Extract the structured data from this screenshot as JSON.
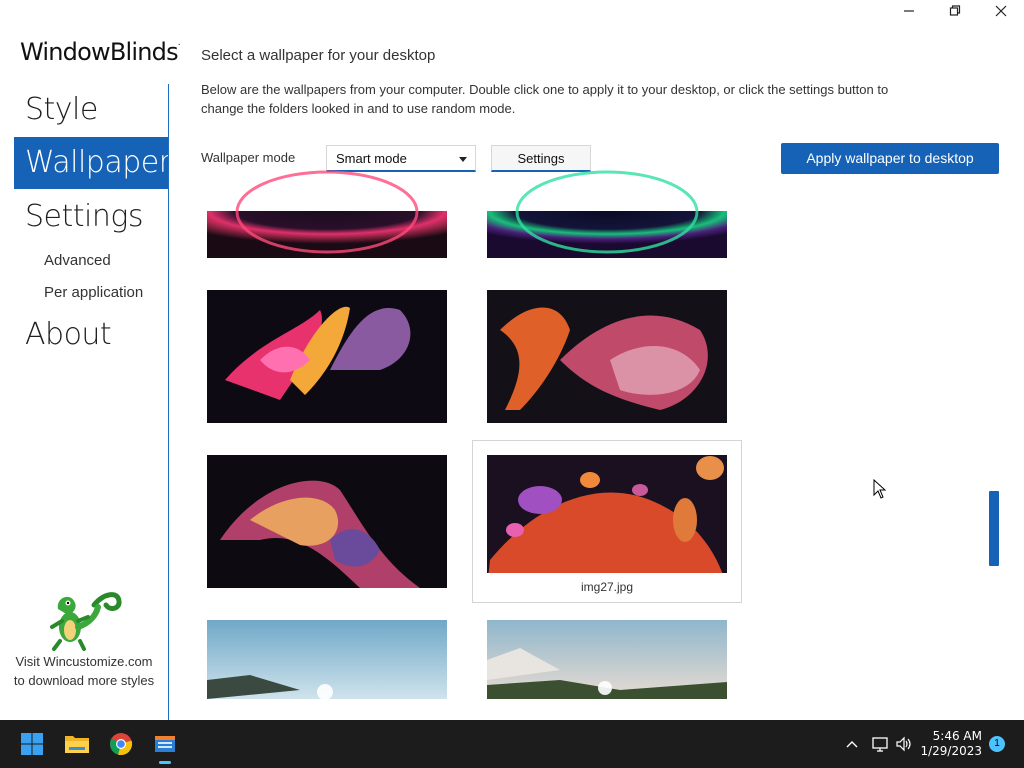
{
  "window": {
    "minimize_icon": "minimize-icon",
    "maximize_icon": "restore-icon",
    "close_icon": "close-icon"
  },
  "sidebar": {
    "logo": "WindowBlinds",
    "logo_mark": ".",
    "items": [
      {
        "label": "Style",
        "active": false
      },
      {
        "label": "Wallpaper",
        "active": true
      },
      {
        "label": "Settings",
        "active": false
      },
      {
        "label": "About",
        "active": false
      }
    ],
    "sub_items": [
      {
        "label": "Advanced"
      },
      {
        "label": "Per application"
      }
    ],
    "visit_text": "Visit Wincustomize.com to download more styles"
  },
  "main": {
    "title": "Select a wallpaper for your desktop",
    "description": "Below are the wallpapers from your computer.  Double click one to apply it to your desktop, or click the settings button to change the folders looked in and to use random mode.",
    "mode_label": "Wallpaper mode",
    "mode_value": "Smart mode",
    "settings_button": "Settings",
    "apply_button": "Apply wallpaper to desktop",
    "hovered_label": "img27.jpg"
  },
  "taskbar": {
    "icons": [
      "windows-start-icon",
      "file-explorer-icon",
      "chrome-icon",
      "windowblinds-icon"
    ],
    "time": "5:46 AM",
    "date": "1/29/2023",
    "notifications": "1"
  },
  "colors": {
    "accent": "#1662b6",
    "taskbar": "#1c1c1c"
  }
}
